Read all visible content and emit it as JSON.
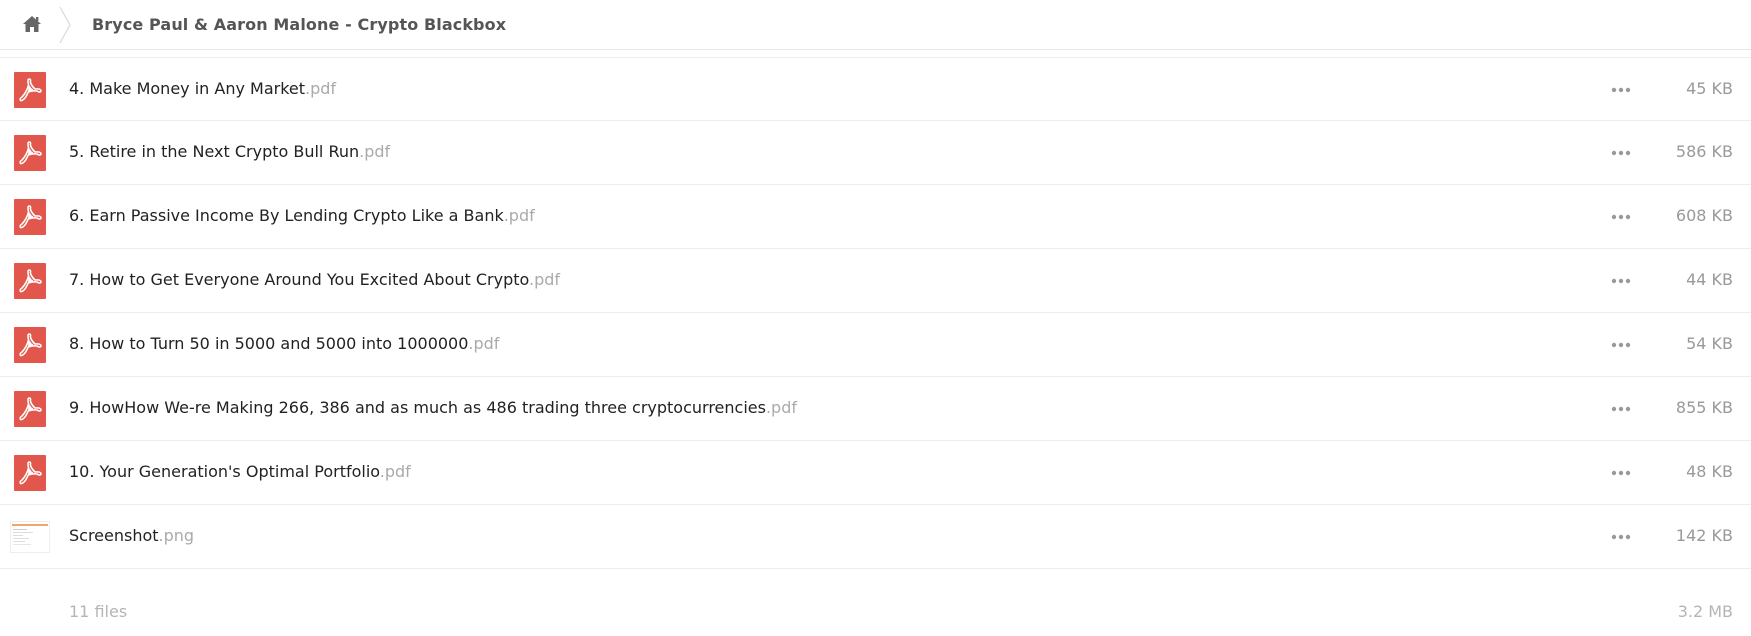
{
  "breadcrumb": {
    "home_icon": "home-icon",
    "title": "Bryce Paul & Aaron Malone - Crypto Blackbox"
  },
  "files": [
    {
      "name": "4. Make Money in Any Market",
      "ext": ".pdf",
      "size": "45 KB",
      "icon": "pdf-icon"
    },
    {
      "name": "5. Retire in the Next Crypto Bull Run",
      "ext": ".pdf",
      "size": "586 KB",
      "icon": "pdf-icon"
    },
    {
      "name": "6. Earn Passive Income By Lending Crypto Like a Bank",
      "ext": ".pdf",
      "size": "608 KB",
      "icon": "pdf-icon"
    },
    {
      "name": "7. How to Get Everyone Around You Excited About Crypto",
      "ext": ".pdf",
      "size": "44 KB",
      "icon": "pdf-icon"
    },
    {
      "name": "8. How to Turn 50 in 5000 and 5000 into 1000000",
      "ext": ".pdf",
      "size": "54 KB",
      "icon": "pdf-icon"
    },
    {
      "name": "9. HowHow We-re Making 266, 386 and as much as 486 trading three cryptocurrencies",
      "ext": ".pdf",
      "size": "855 KB",
      "icon": "pdf-icon"
    },
    {
      "name": "10. Your Generation's Optimal Portfolio",
      "ext": ".pdf",
      "size": "48 KB",
      "icon": "pdf-icon"
    },
    {
      "name": "Screenshot",
      "ext": ".png",
      "size": "142 KB",
      "icon": "image-thumbnail"
    }
  ],
  "summary": {
    "count": "11 files",
    "total": "3.2 MB"
  },
  "colors": {
    "pdf_red": "#e2574c",
    "ext_gray": "#aaaaaa",
    "size_gray": "#999999"
  }
}
